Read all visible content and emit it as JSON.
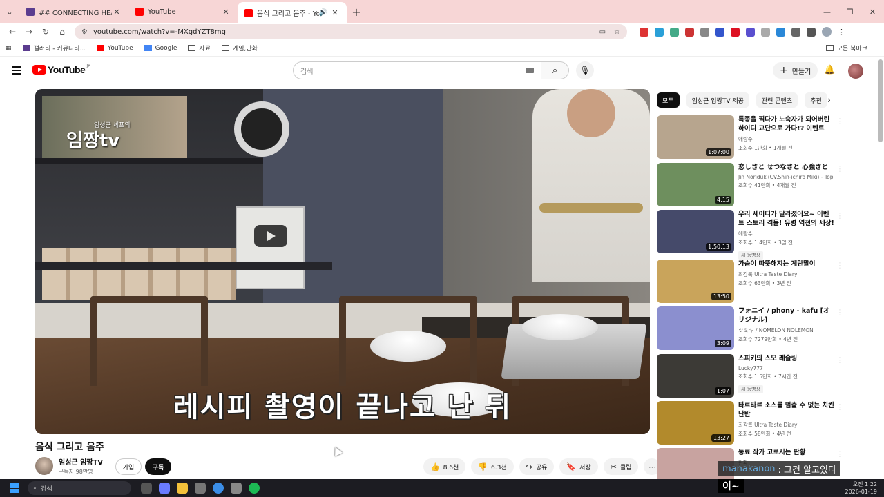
{
  "browser": {
    "tabs": [
      {
        "title": "## CONNECTING HEARTS! 디",
        "favicon_color": "#5b3c8f",
        "active": false
      },
      {
        "title": "YouTube",
        "favicon_color": "#ff0000",
        "active": false
      },
      {
        "title": "음식 그리고 음주 - YouTub",
        "favicon_color": "#ff0000",
        "active": true
      }
    ],
    "url": "youtube.com/watch?v=-MXgdYZT8mg",
    "bookmarks": [
      {
        "label": "갤러리 - 커뮤니티...",
        "color": "#5b3c8f"
      },
      {
        "label": "YouTube",
        "color": "#ff0000"
      },
      {
        "label": "Google",
        "color": "#4285f4"
      },
      {
        "label": "자료",
        "color": "#555555"
      },
      {
        "label": "게임,만화",
        "color": "#555555"
      }
    ],
    "all_bookmarks": "모든 북마크"
  },
  "youtube": {
    "logo": "YouTube",
    "region": "JP",
    "search_placeholder": "검색",
    "create_label": "만들기"
  },
  "video": {
    "watermark_top": "임성근 셰프의",
    "watermark": "임짱tv",
    "subtitle": "레시피 촬영이 끝나고 난 뒤",
    "title": "음식 그리고 음주",
    "channel": "임성근 임짱TV",
    "subscribers": "구독자 98만명",
    "join": "가입",
    "subscribe": "구독",
    "likes": "8.6천",
    "dislikes": "6.3천",
    "share": "공유",
    "save": "저장",
    "clip": "클립"
  },
  "chips": [
    "모두",
    "임성근 임짱TV 제공",
    "관련 콘텐츠",
    "추천"
  ],
  "recommendations": [
    {
      "title": "특종을 찍다가 노숙자가 되어버린 하이디 교단으로 가다!? 이벤트 스...",
      "channel": "애랑수",
      "stats": "조회수 1만회 • 1개월 전",
      "duration": "1:07:00",
      "new": "",
      "thumb": "#b7a58e"
    },
    {
      "title": "恋しさと せつなさと 心強さと",
      "channel": "Jin Noriduki(CV.Shin-ichiro Miki) - Topic",
      "stats": "조회수 41만회 • 4개월 전",
      "duration": "4:15",
      "new": "",
      "thumb": "#6e8f5e"
    },
    {
      "title": "우리 세이디가 달라졌어요~ 이벤트 스토리 격돌! 유령 역전의 세상! ...",
      "channel": "애랑수",
      "stats": "조회수 1.4만회 • 3일 전",
      "duration": "1:50:13",
      "new": "새 동영상",
      "thumb": "#454a6a"
    },
    {
      "title": "가슴이 따뜻해지는 계란말이",
      "channel": "최강록 Ultra Taste Diary",
      "stats": "조회수 63만회 • 3년 전",
      "duration": "13:50",
      "new": "",
      "thumb": "#c9a45b"
    },
    {
      "title": "フォニイ / phony - kafu [オリジナル]",
      "channel": "ツミキ / NOMELON NOLEMON",
      "stats": "조회수 7279만회 • 4년 전",
      "duration": "3:09",
      "new": "",
      "thumb": "#8b8fcf"
    },
    {
      "title": "스피키의 스모 레슬링",
      "channel": "Lucky777",
      "stats": "조회수 1.5만회 • 7시간 전",
      "duration": "1:07",
      "new": "새 동영상",
      "thumb": "#3c3a36"
    },
    {
      "title": "타르타르 소스를 멈출 수 없는 치킨난반",
      "channel": "최강록 Ultra Taste Diary",
      "stats": "조회수 58만회 • 4년 전",
      "duration": "13:27",
      "new": "",
      "thumb": "#b28a2c"
    },
    {
      "title": "동료 작가 고로시는 판황",
      "channel": "판황",
      "stats": "",
      "duration": "",
      "new": "",
      "thumb": "#c8a3a0"
    }
  ],
  "overlay": {
    "user": "manakanon",
    "message": ": 그건 알고있다",
    "message2": "이~"
  },
  "taskbar": {
    "search": "검색",
    "time": "오전 1:22",
    "date": "2026-01-19"
  }
}
